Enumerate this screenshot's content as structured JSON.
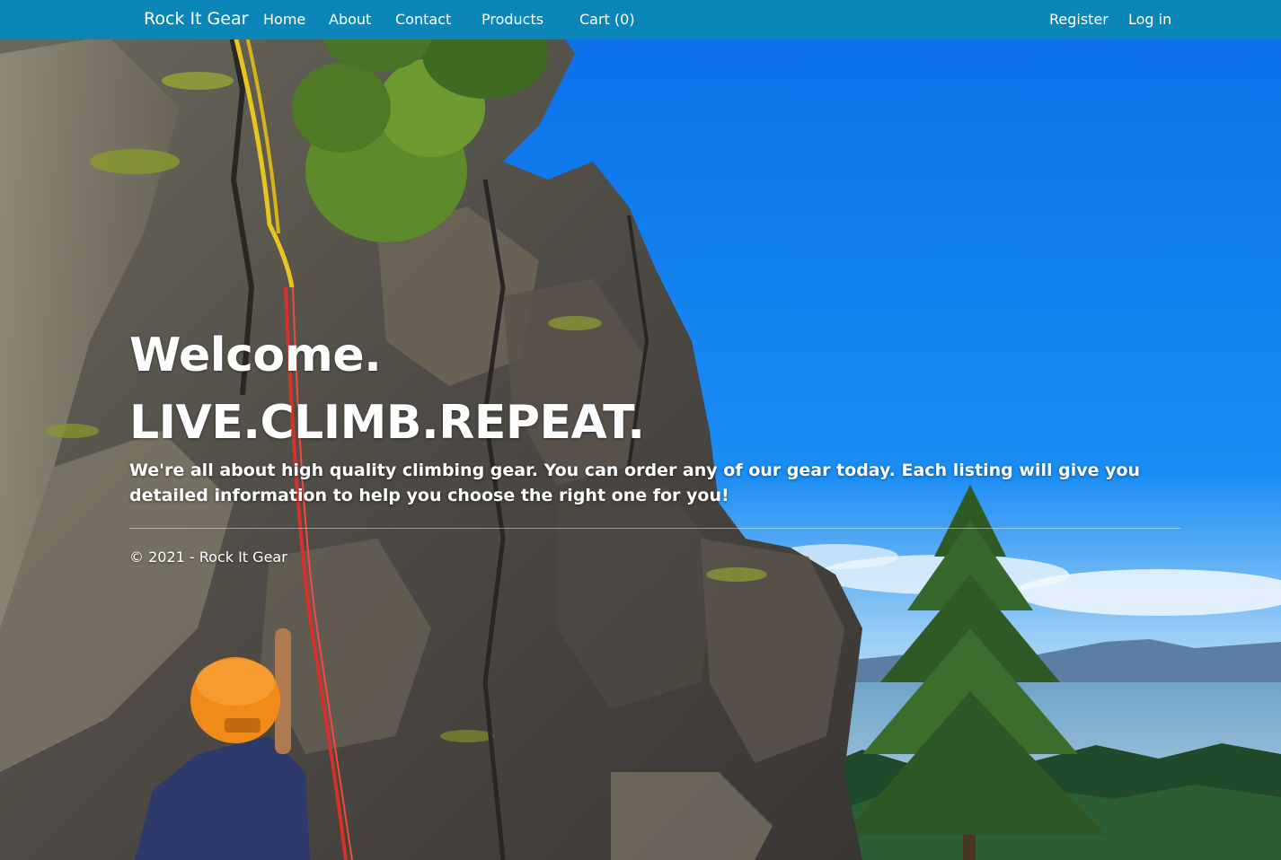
{
  "navbar": {
    "brand": "Rock It Gear",
    "links": {
      "home": "Home",
      "about": "About",
      "contact": "Contact",
      "products": "Products",
      "cart": "Cart (0)",
      "register": "Register",
      "login": "Log in"
    },
    "background_color": "#0a87b8"
  },
  "hero": {
    "welcome": "Welcome.",
    "tagline": "LIVE.CLIMB.REPEAT.",
    "description": "We're all about high quality climbing gear. You can order any of our gear today. Each listing will give you detailed information to help you choose the right one for you!"
  },
  "footer": {
    "copyright": "© 2021 - Rock It Gear"
  }
}
